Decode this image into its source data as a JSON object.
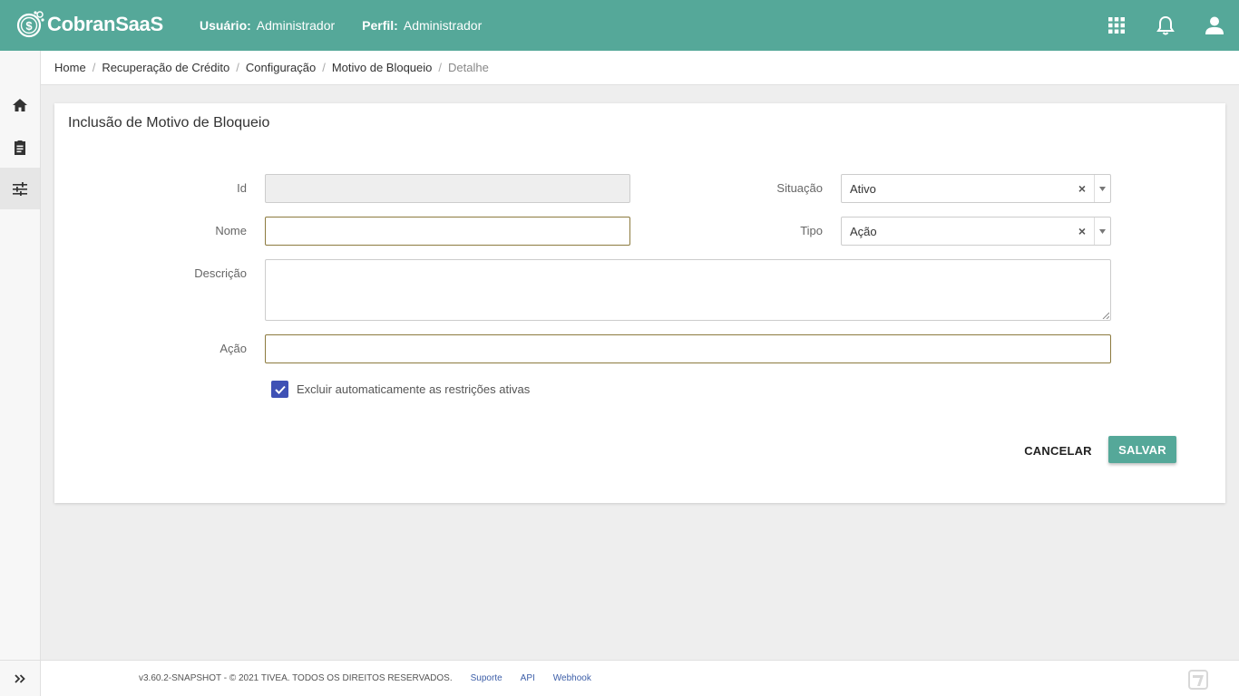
{
  "app": {
    "name": "CobranSaaS"
  },
  "header": {
    "user_label": "Usuário:",
    "user_value": "Administrador",
    "profile_label": "Perfil:",
    "profile_value": "Administrador",
    "icons": [
      "apps-grid-icon",
      "bell-icon",
      "user-icon"
    ]
  },
  "sidebar": {
    "items": [
      {
        "icon": "home-icon"
      },
      {
        "icon": "clipboard-icon"
      },
      {
        "icon": "settings-sliders-icon",
        "active": true
      }
    ],
    "expand_icon": "double-chevron-right-icon"
  },
  "breadcrumb": [
    "Home",
    "Recuperação de Crédito",
    "Configuração",
    "Motivo de Bloqueio",
    "Detalhe"
  ],
  "card": {
    "title": "Inclusão de Motivo de Bloqueio",
    "fields": {
      "id": {
        "label": "Id",
        "value": ""
      },
      "nome": {
        "label": "Nome",
        "value": ""
      },
      "descricao": {
        "label": "Descrição",
        "value": ""
      },
      "acao": {
        "label": "Ação",
        "value": ""
      },
      "situacao": {
        "label": "Situação",
        "value": "Ativo"
      },
      "tipo": {
        "label": "Tipo",
        "value": "Ação"
      }
    },
    "checkbox": {
      "label": "Excluir automaticamente as restrições ativas",
      "checked": true
    },
    "buttons": {
      "cancel": "CANCELAR",
      "save": "SALVAR"
    }
  },
  "footer": {
    "copyright": "v3.60.2-SNAPSHOT - © 2021 TIVEA. TODOS OS DIREITOS RESERVADOS.",
    "links": [
      "Suporte",
      "API",
      "Webhook"
    ]
  },
  "colors": {
    "primary": "#55a899",
    "checkbox": "#3f51b5",
    "link": "#3c5ea8"
  }
}
